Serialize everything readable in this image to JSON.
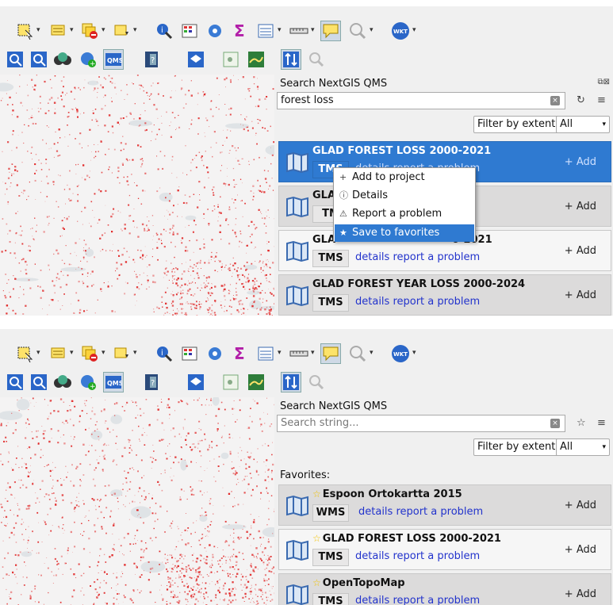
{
  "panel_top": {
    "dock_title": "Search NextGIS QMS",
    "search_value": "forest loss",
    "filter_label": "Filter by extent",
    "combo_value": "All",
    "results": [
      {
        "name": "GLAD FOREST LOSS 2000-2021",
        "type": "TMS",
        "details": "details",
        "report": "report a problem",
        "add": "+ Add"
      },
      {
        "name": "GLA",
        "type": "TM",
        "details": "",
        "report": "",
        "add": "+ Add"
      },
      {
        "name": "GLA",
        "name_tail": "0-2021",
        "type": "TMS",
        "details": "details",
        "report": "report a problem",
        "add": "+ Add"
      },
      {
        "name": "GLAD FOREST YEAR LOSS 2000-2024",
        "type": "TMS",
        "details": "details",
        "report": "report a problem",
        "add": "+ Add"
      }
    ],
    "context_menu": [
      {
        "label": "Add to project",
        "icon": "plus-icon"
      },
      {
        "label": "Details",
        "icon": "info-icon"
      },
      {
        "label": "Report a problem",
        "icon": "warning-icon"
      },
      {
        "label": "Save to favorites",
        "icon": "star-icon"
      }
    ]
  },
  "panel_bottom": {
    "dock_title": "Search NextGIS QMS",
    "search_placeholder": "Search string...",
    "filter_label": "Filter by extent",
    "combo_value": "All",
    "favorites_label": "Favorites:",
    "results": [
      {
        "name": "Espoon Ortokartta 2015",
        "type": "WMS",
        "details": "details",
        "report": "report a problem",
        "add": "+ Add"
      },
      {
        "name": "GLAD FOREST LOSS 2000-2021",
        "type": "TMS",
        "details": "details",
        "report": "report a problem",
        "add": "+ Add"
      },
      {
        "name": "OpenTopoMap",
        "type": "TMS",
        "details": "details",
        "report": "report a problem",
        "add": "+ Add"
      }
    ]
  },
  "toolbar": {
    "wkt_label": "WKT",
    "qms_label": "QMS"
  },
  "colors": {
    "selection": "#2f7ad1",
    "link": "#2233cc",
    "map_loss": "#e02020",
    "favorite_star": "#f2c200"
  }
}
